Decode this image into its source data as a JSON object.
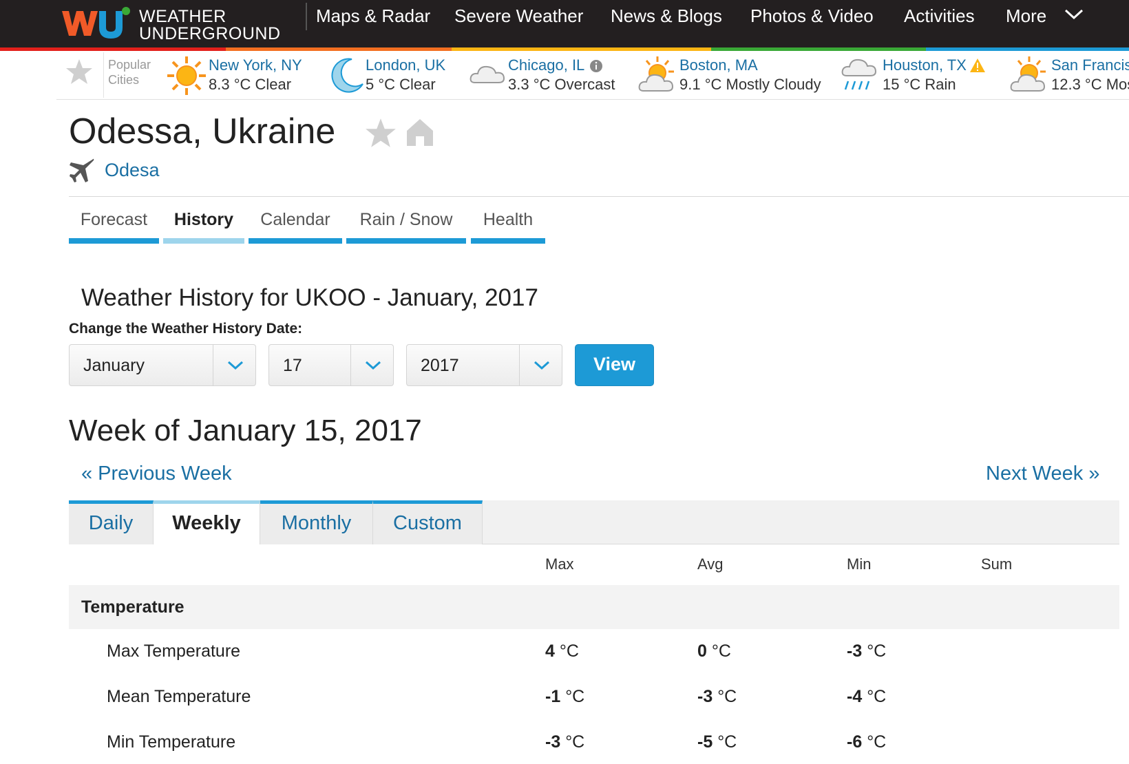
{
  "brand": {
    "logo_mark": "wu",
    "logo_line1": "WEATHER",
    "logo_line2": "UNDERGROUND"
  },
  "nav": {
    "items": [
      "Maps & Radar",
      "Severe Weather",
      "News & Blogs",
      "Photos & Video",
      "Activities",
      "More"
    ]
  },
  "popular": {
    "label_line1": "Popular",
    "label_line2": "Cities",
    "cities": [
      {
        "name": "New York, NY",
        "weather": "8.3 °C Clear",
        "icon": "sun-icon"
      },
      {
        "name": "London, UK",
        "weather": "5 °C Clear",
        "icon": "moon-icon"
      },
      {
        "name": "Chicago, IL",
        "weather": "3.3 °C Overcast",
        "icon": "cloud-icon"
      },
      {
        "name": "Boston, MA",
        "weather": "9.1 °C Mostly Cloudy",
        "icon": "sun-cloud-icon"
      },
      {
        "name": "Houston, TX",
        "weather": "15 °C Rain",
        "icon": "rain-icon"
      },
      {
        "name": "San Francis",
        "weather": "12.3 °C Mos",
        "icon": "sun-cloud-icon"
      }
    ]
  },
  "location": {
    "title": "Odessa, Ukraine",
    "station": "Odesa"
  },
  "section_tabs": [
    "Forecast",
    "History",
    "Calendar",
    "Rain / Snow",
    "Health"
  ],
  "history": {
    "title": "Weather History for UKOO - January, 2017",
    "date_label": "Change the Weather History Date:",
    "month": "January",
    "day": "17",
    "year": "2017",
    "view_label": "View"
  },
  "week": {
    "title": "Week of January 15, 2017",
    "prev": "« Previous Week",
    "next": "Next Week »"
  },
  "period_tabs": [
    "Daily",
    "Weekly",
    "Monthly",
    "Custom"
  ],
  "table": {
    "columns": [
      "Max",
      "Avg",
      "Min",
      "Sum"
    ],
    "group": "Temperature",
    "rows": [
      {
        "label": "Max Temperature",
        "max": "4",
        "avg": "0",
        "min": "-3",
        "unit": "°C"
      },
      {
        "label": "Mean Temperature",
        "max": "-1",
        "avg": "-3",
        "min": "-4",
        "unit": "°C"
      },
      {
        "label": "Min Temperature",
        "max": "-3",
        "avg": "-5",
        "min": "-6",
        "unit": "°C"
      }
    ]
  },
  "colors": {
    "accent": "#1d9ad6",
    "link": "#1a6fa3",
    "topbar": "#231f20"
  }
}
